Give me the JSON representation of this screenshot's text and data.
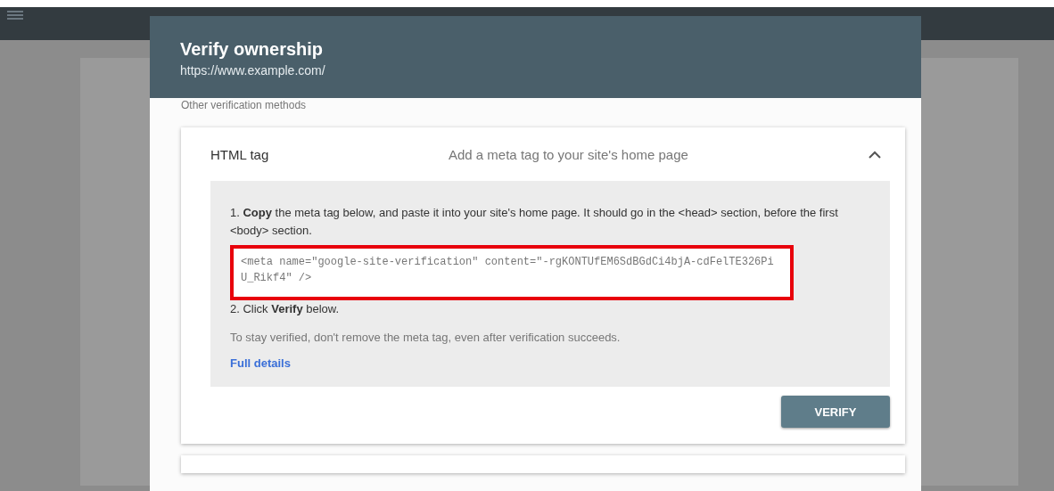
{
  "dialog": {
    "title": "Verify ownership",
    "subtitle": "https://www.example.com/",
    "section_label": "Other verification methods"
  },
  "method": {
    "name": "HTML tag",
    "description": "Add a meta tag to your site's home page",
    "expanded": true,
    "steps": [
      "1. **Copy** the meta tag below, and paste it into your site's home page. It should go in the <head> section, before the first <body> section."
    ],
    "code": "<meta name=\"google-site-verification\" content=\"-rgKONTUfEM6SdBGdCi4bjA-cdFelTE326PiU_Rikf4\" />",
    "code_highlighted": true,
    "after_steps": [
      "2. Click **Verify** below."
    ],
    "note": "To stay verified, don't remove the meta tag, even after verification succeeds.",
    "link": "Full details",
    "button": "VERIFY"
  }
}
